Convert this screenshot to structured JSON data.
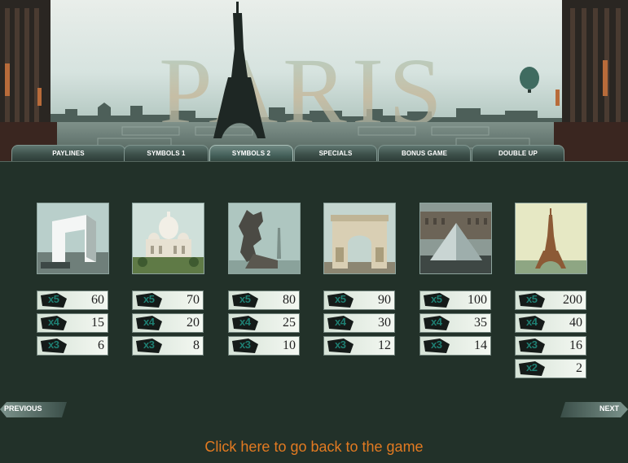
{
  "banner": {
    "title": "PARIS"
  },
  "tabs": [
    {
      "label": "PAYLINES"
    },
    {
      "label": "SYMBOLS 1"
    },
    {
      "label": "SYMBOLS 2"
    },
    {
      "label": "SPECIALS"
    },
    {
      "label": "BONUS GAME"
    },
    {
      "label": "DOUBLE UP"
    }
  ],
  "active_tab": "SYMBOLS 2",
  "symbols": [
    {
      "icon": "grande-arche-icon",
      "pays": [
        {
          "mult": "x5",
          "value": "60"
        },
        {
          "mult": "x4",
          "value": "15"
        },
        {
          "mult": "x3",
          "value": "6"
        }
      ]
    },
    {
      "icon": "sacre-coeur-icon",
      "pays": [
        {
          "mult": "x5",
          "value": "70"
        },
        {
          "mult": "x4",
          "value": "20"
        },
        {
          "mult": "x3",
          "value": "8"
        }
      ]
    },
    {
      "icon": "gargoyle-icon",
      "pays": [
        {
          "mult": "x5",
          "value": "80"
        },
        {
          "mult": "x4",
          "value": "25"
        },
        {
          "mult": "x3",
          "value": "10"
        }
      ]
    },
    {
      "icon": "arc-de-triomphe-icon",
      "pays": [
        {
          "mult": "x5",
          "value": "90"
        },
        {
          "mult": "x4",
          "value": "30"
        },
        {
          "mult": "x3",
          "value": "12"
        }
      ]
    },
    {
      "icon": "louvre-pyramid-icon",
      "pays": [
        {
          "mult": "x5",
          "value": "100"
        },
        {
          "mult": "x4",
          "value": "35"
        },
        {
          "mult": "x3",
          "value": "14"
        }
      ]
    },
    {
      "icon": "eiffel-tower-icon",
      "pays": [
        {
          "mult": "x5",
          "value": "200"
        },
        {
          "mult": "x4",
          "value": "40"
        },
        {
          "mult": "x3",
          "value": "16"
        },
        {
          "mult": "x2",
          "value": "2"
        }
      ]
    }
  ],
  "nav": {
    "previous": "PREVIOUS",
    "next": "NEXT"
  },
  "back_link": "Click here to go back to the game",
  "colors": {
    "accent_orange": "#e27a21",
    "background": "#223129",
    "multiplier_teal": "#1e7e72"
  }
}
